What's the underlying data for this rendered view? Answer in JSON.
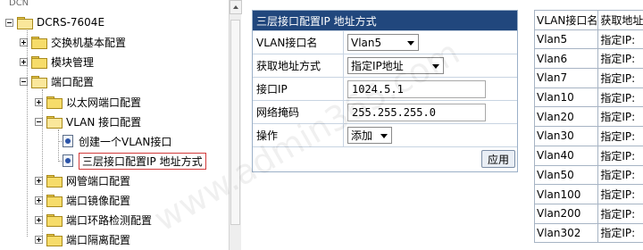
{
  "tree": {
    "header": "DCN",
    "root": "DCRS-7604E",
    "items": [
      {
        "label": "交换机基本配置"
      },
      {
        "label": "模块管理"
      },
      {
        "label": "端口配置"
      },
      {
        "label": "以太网端口配置"
      },
      {
        "label": "VLAN 接口配置"
      },
      {
        "label": "创建一个VLAN接口"
      },
      {
        "label": "三层接口配置IP 地址方式"
      },
      {
        "label": "网管端口配置"
      },
      {
        "label": "端口镜像配置"
      },
      {
        "label": "端口环路检测配置"
      },
      {
        "label": "端口隔离配置"
      }
    ]
  },
  "form": {
    "title": "三层接口配置IP 地址方式",
    "vlan_label": "VLAN接口名",
    "vlan_value": "Vlan5",
    "method_label": "获取地址方式",
    "method_value": "指定IP地址",
    "ip_label": "接口IP",
    "ip_value": "1024.5.1",
    "mask_label": "网络掩码",
    "mask_value": "255.255.255.0",
    "op_label": "操作",
    "op_value": "添加",
    "apply_label": "应用"
  },
  "vlan_table": {
    "headers": [
      "VLAN接口名",
      "获取地址"
    ],
    "rows": [
      [
        "Vlan5",
        "指定IP:"
      ],
      [
        "Vlan6",
        "指定IP:"
      ],
      [
        "Vlan7",
        "指定IP:"
      ],
      [
        "Vlan10",
        "指定IP:"
      ],
      [
        "Vlan20",
        "指定IP:"
      ],
      [
        "Vlan30",
        "指定IP:"
      ],
      [
        "Vlan40",
        "指定IP:"
      ],
      [
        "Vlan50",
        "指定IP:"
      ],
      [
        "Vlan100",
        "指定IP:"
      ],
      [
        "Vlan200",
        "指定IP:"
      ],
      [
        "Vlan302",
        "指定IP:"
      ]
    ]
  },
  "watermark": "www.admin365.com",
  "colors": {
    "form_title_bg": "#21477d",
    "selected_border": "#d23b3b"
  }
}
